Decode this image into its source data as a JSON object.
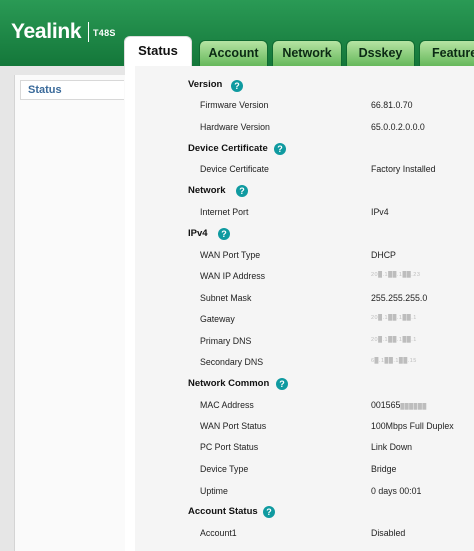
{
  "header": {
    "brand": "Yealink",
    "model": "T48S"
  },
  "tabs": [
    {
      "label": "Status"
    },
    {
      "label": "Account"
    },
    {
      "label": "Network"
    },
    {
      "label": "Dsskey"
    },
    {
      "label": "Feature"
    }
  ],
  "sidebar": {
    "items": [
      {
        "label": "Status"
      }
    ]
  },
  "help_glyph": "?",
  "sections": {
    "version": {
      "title": "Version",
      "rows": [
        {
          "label": "Firmware Version",
          "value": "66.81.0.70"
        },
        {
          "label": "Hardware Version",
          "value": "65.0.0.2.0.0.0"
        }
      ]
    },
    "device_certificate": {
      "title": "Device Certificate",
      "rows": [
        {
          "label": "Device Certificate",
          "value": "Factory Installed"
        }
      ]
    },
    "network": {
      "title": "Network",
      "rows": [
        {
          "label": "Internet Port",
          "value": "IPv4"
        }
      ]
    },
    "ipv4": {
      "title": "IPv4",
      "rows": [
        {
          "label": "WAN Port Type",
          "value": "DHCP"
        },
        {
          "label": "WAN IP Address",
          "value": "20█.1██.1██.23"
        },
        {
          "label": "Subnet Mask",
          "value": "255.255.255.0"
        },
        {
          "label": "Gateway",
          "value": "20█.1██.1██.1"
        },
        {
          "label": "Primary DNS",
          "value": "20█.1██.1██.1"
        },
        {
          "label": "Secondary DNS",
          "value": "6█.1██.1██.15"
        }
      ]
    },
    "network_common": {
      "title": "Network Common",
      "rows": [
        {
          "label": "MAC Address",
          "value": "001565",
          "redacted_suffix": "██████"
        },
        {
          "label": "WAN Port Status",
          "value": "100Mbps Full Duplex"
        },
        {
          "label": "PC Port Status",
          "value": "Link Down"
        },
        {
          "label": "Device Type",
          "value": "Bridge"
        },
        {
          "label": "Uptime",
          "value": "0 days 00:01"
        }
      ]
    },
    "account_status": {
      "title": "Account Status",
      "rows": [
        {
          "label": "Account1",
          "value": "Disabled"
        }
      ]
    }
  }
}
